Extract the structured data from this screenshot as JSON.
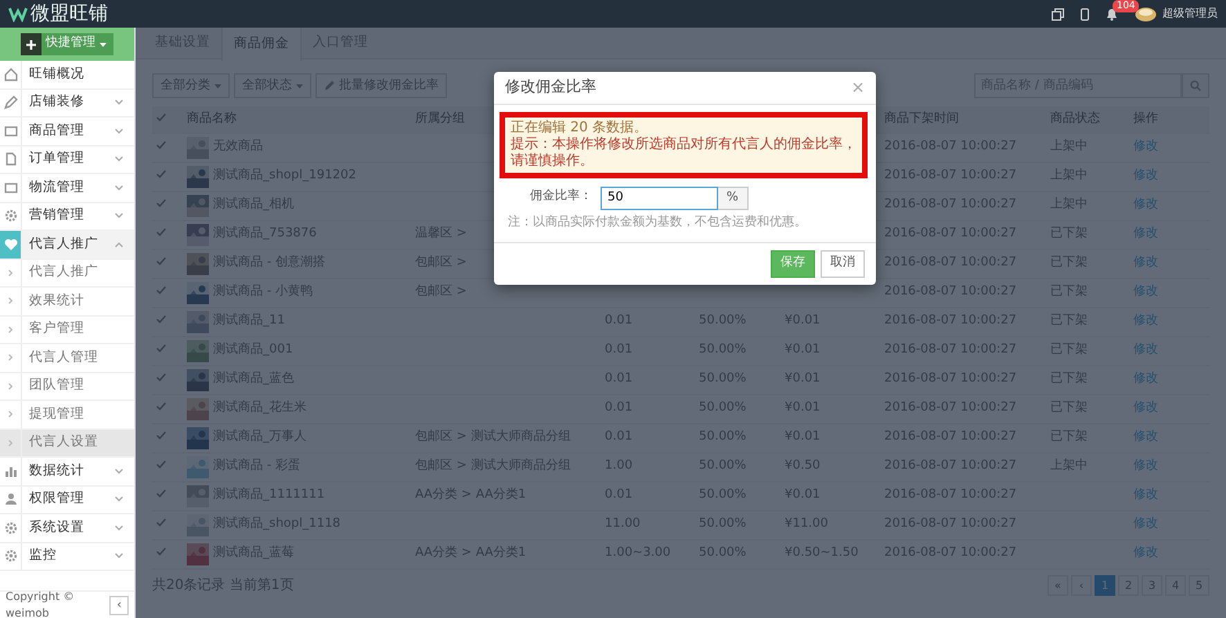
{
  "topbar": {
    "logo": "微盟旺铺",
    "notification_count": "104",
    "user": "超级管理员"
  },
  "sidebar": {
    "quick_button": "快捷管理",
    "items": [
      {
        "label": "旺铺概况",
        "kind": "link",
        "expanded": false
      },
      {
        "label": "店铺装修",
        "kind": "menu",
        "expanded": false
      },
      {
        "label": "商品管理",
        "kind": "menu",
        "expanded": false
      },
      {
        "label": "订单管理",
        "kind": "menu",
        "expanded": false
      },
      {
        "label": "物流管理",
        "kind": "menu",
        "expanded": false
      },
      {
        "label": "营销管理",
        "kind": "menu",
        "expanded": false
      },
      {
        "label": "代言人推广",
        "kind": "menu",
        "expanded": true,
        "children": [
          {
            "label": "代言人推广",
            "selected": false
          },
          {
            "label": "效果统计",
            "selected": false
          },
          {
            "label": "客户管理",
            "selected": false
          },
          {
            "label": "代言人管理",
            "selected": false
          },
          {
            "label": "团队管理",
            "selected": false
          },
          {
            "label": "提现管理",
            "selected": false
          },
          {
            "label": "代言人设置",
            "selected": true
          }
        ]
      },
      {
        "label": "数据统计",
        "kind": "menu",
        "expanded": false
      },
      {
        "label": "权限管理",
        "kind": "menu",
        "expanded": false
      },
      {
        "label": "系统设置",
        "kind": "menu",
        "expanded": false
      },
      {
        "label": "监控",
        "kind": "menu",
        "expanded": false
      }
    ],
    "copyright": "Copyright © weimob",
    "collapse_button": "‹"
  },
  "tabs": [
    {
      "label": "基础设置",
      "selected": false
    },
    {
      "label": "商品佣金",
      "selected": true
    },
    {
      "label": "入口管理",
      "selected": false
    }
  ],
  "toolbar": {
    "category_filter": "全部分类",
    "status_filter": "全部状态",
    "batch_button": "批量修改佣金比率",
    "search": {
      "placeholder": "商品名称 / 商品编码"
    }
  },
  "table": {
    "columns": [
      "商品名称",
      "所属分组",
      "商品下架时间",
      "商品状态",
      "操作"
    ],
    "rows": [
      {
        "checked": true,
        "name": "无效商品",
        "time": "2016-08-07 10:00:27",
        "status": "上架中",
        "action": "修改"
      },
      {
        "checked": true,
        "name": "测试商品_shopl_191202",
        "time": "2016-08-07 10:00:27",
        "status": "上架中",
        "action": "修改"
      },
      {
        "checked": true,
        "name": "测试商品_相机",
        "time": "2016-08-07 10:00:27",
        "status": "上架中",
        "action": "修改"
      },
      {
        "checked": true,
        "name": "测试商品_753876",
        "group": "温馨区 >",
        "time": "2016-08-07 10:00:27",
        "status": "已下架",
        "action": "修改"
      },
      {
        "checked": true,
        "name": "测试商品 - 创意潮搭",
        "group": "包邮区 >",
        "time": "2016-08-07 10:00:27",
        "status": "已下架",
        "action": "修改"
      },
      {
        "checked": true,
        "name": "测试商品 - 小黄鸭",
        "group": "包邮区 >",
        "time": "2016-08-07 10:00:27",
        "status": "已下架",
        "action": "修改"
      },
      {
        "checked": true,
        "name": "测试商品_11",
        "price": "0.01",
        "rate": "50.00%",
        "commission": "¥0.01",
        "time": "2016-08-07 10:00:27",
        "status": "已下架",
        "action": "修改"
      },
      {
        "checked": true,
        "name": "测试商品_001",
        "price": "0.01",
        "rate": "50.00%",
        "commission": "¥0.01",
        "time": "2016-08-07 10:00:27",
        "status": "已下架",
        "action": "修改"
      },
      {
        "checked": true,
        "name": "测试商品_蓝色",
        "price": "0.01",
        "rate": "50.00%",
        "commission": "¥0.01",
        "time": "2016-08-07 10:00:27",
        "status": "已下架",
        "action": "修改"
      },
      {
        "checked": true,
        "name": "测试商品_花生米",
        "price": "0.01",
        "rate": "50.00%",
        "commission": "¥0.01",
        "time": "2016-08-07 10:00:27",
        "status": "已下架",
        "action": "修改"
      },
      {
        "checked": true,
        "name": "测试商品_万事人",
        "group": "包邮区 > 测试大师商品分组",
        "price": "0.01",
        "rate": "50.00%",
        "commission": "¥0.01",
        "time": "2016-08-07 10:00:27",
        "status": "已下架",
        "action": "修改"
      },
      {
        "checked": true,
        "name": "测试商品 - 彩蛋",
        "group": "包邮区 > 测试大师商品分组",
        "price": "1.00",
        "rate": "50.00%",
        "commission": "¥0.50",
        "time": "2016-08-07 10:00:27",
        "status": "上架中",
        "action": "修改"
      },
      {
        "checked": true,
        "name": "测试商品_1111111",
        "group": "AA分类 > AA分类1",
        "price": "0.01",
        "rate": "50.00%",
        "commission": "¥0.01",
        "time": "2016-08-07 10:00:27",
        "action": "修改"
      },
      {
        "checked": true,
        "name": "测试商品_shopl_1118",
        "price": "11.00",
        "rate": "50.00%",
        "commission": "¥11.00",
        "time": "2016-08-07 10:00:27",
        "action": "修改"
      },
      {
        "checked": true,
        "name": "测试商品_蓝莓",
        "group": "AA分类 > AA分类1",
        "price": "1.00~3.00",
        "rate": "50.00%",
        "commission": "¥0.50~1.50",
        "time": "2016-08-07 10:00:27",
        "action": "修改"
      }
    ]
  },
  "footer": {
    "summary": "共20条记录 当前第1页",
    "pages": [
      {
        "label": "1",
        "selected": true
      },
      {
        "label": "2",
        "selected": false
      },
      {
        "label": "3",
        "selected": false
      },
      {
        "label": "4",
        "selected": false
      },
      {
        "label": "5",
        "selected": false
      }
    ],
    "prev": "‹",
    "first": "«"
  },
  "modal": {
    "title": "修改佣金比率",
    "close": "×",
    "alert": {
      "highlighted": true,
      "lines": [
        "正在编辑 20 条数据。",
        "提示：本操作将修改所选商品对所有代言人的佣金比率，请谨慎操作。"
      ]
    },
    "field": {
      "label": "佣金比率：",
      "value": "50",
      "unit": "%"
    },
    "note": "注：以商品实际付款金额为基数，不包含运费和优惠。",
    "buttons": [
      {
        "label": "保存",
        "kind": "primary"
      },
      {
        "label": "取消",
        "kind": "secondary"
      }
    ]
  }
}
